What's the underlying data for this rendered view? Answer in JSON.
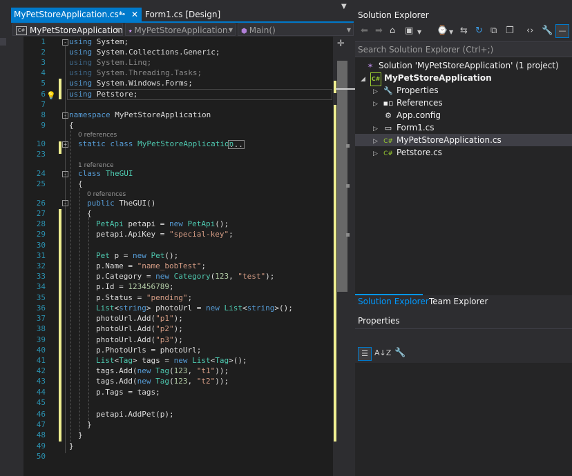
{
  "tabs": {
    "active_label": "MyPetStoreApplication.cs*",
    "pin_icon": "pin-icon",
    "close_icon": "close-icon",
    "second_label": "Form1.cs [Design]"
  },
  "nav": {
    "project": "MyPetStoreApplication",
    "class": "MyPetStoreApplication.",
    "member": "Main()"
  },
  "code": {
    "line_numbers": [
      "1",
      "2",
      "3",
      "4",
      "5",
      "6",
      "7",
      "8",
      "9",
      "10",
      "23",
      "24",
      "25",
      "26",
      "27",
      "28",
      "29",
      "30",
      "31",
      "32",
      "33",
      "34",
      "35",
      "36",
      "37",
      "38",
      "39",
      "40",
      "41",
      "42",
      "43",
      "44",
      "45",
      "46",
      "47",
      "48",
      "49",
      "50"
    ],
    "refs": {
      "r10": "0 references",
      "r24": "1 reference",
      "r26": "0 references"
    },
    "l1": [
      "using",
      " System;"
    ],
    "l2": [
      "using",
      " System.Collections.Generic;"
    ],
    "l3": [
      "using",
      " System.Linq;"
    ],
    "l4": [
      "using",
      " System.Threading.Tasks;"
    ],
    "l5": [
      "using",
      " System.Windows.Forms;"
    ],
    "l6": [
      "using",
      " Petstore;"
    ],
    "l8": [
      "namespace",
      " MyPetStoreApplication"
    ],
    "l9": "{",
    "l10": [
      "static",
      " ",
      "class",
      " ",
      "MyPetStoreApplication",
      "..."
    ],
    "l24": [
      "class",
      " ",
      "TheGUI"
    ],
    "l25": "{",
    "l26": [
      "public",
      " TheGUI()"
    ],
    "l27": "{",
    "l28": [
      "PetApi",
      " petapi = ",
      "new",
      " ",
      "PetApi",
      "();"
    ],
    "l29": [
      "petapi.ApiKey = ",
      "\"special-key\"",
      ";"
    ],
    "l31": [
      "Pet",
      " p = ",
      "new",
      " ",
      "Pet",
      "();"
    ],
    "l32": [
      "p.Name = ",
      "\"name_bobTest\"",
      ";"
    ],
    "l33": [
      "p.Category = ",
      "new",
      " ",
      "Category",
      "(",
      "123",
      ", ",
      "\"test\"",
      ");"
    ],
    "l34": [
      "p.Id = ",
      "123456789",
      ";"
    ],
    "l35": [
      "p.Status = ",
      "\"pending\"",
      ";"
    ],
    "l36": [
      "List",
      "<",
      "string",
      "> photoUrl = ",
      "new",
      " ",
      "List",
      "<",
      "string",
      ">();"
    ],
    "l37": [
      "photoUrl.Add(",
      "\"p1\"",
      ");"
    ],
    "l38": [
      "photoUrl.Add(",
      "\"p2\"",
      ");"
    ],
    "l39": [
      "photoUrl.Add(",
      "\"p3\"",
      ");"
    ],
    "l40": "p.PhotoUrls = photoUrl;",
    "l41": [
      "List",
      "<",
      "Tag",
      "> tags = ",
      "new",
      " ",
      "List",
      "<",
      "Tag",
      ">();"
    ],
    "l42": [
      "tags.Add(",
      "new",
      " ",
      "Tag",
      "(",
      "123",
      ", ",
      "\"t1\"",
      "));"
    ],
    "l43": [
      "tags.Add(",
      "new",
      " ",
      "Tag",
      "(",
      "123",
      ", ",
      "\"t2\"",
      "));"
    ],
    "l44": "p.Tags = tags;",
    "l46": "petapi.AddPet(p);",
    "l47": "}",
    "l48": "}",
    "l49": "}"
  },
  "solution_explorer": {
    "title": "Solution Explorer",
    "search_placeholder": "Search Solution Explorer (Ctrl+;)",
    "solution_label": "Solution 'MyPetStoreApplication' (1 project)",
    "project_label": "MyPetStoreApplication",
    "items": [
      {
        "label": "Properties",
        "icon": "wrench-icon"
      },
      {
        "label": "References",
        "icon": "references-icon"
      },
      {
        "label": "App.config",
        "icon": "config-file-icon"
      },
      {
        "label": "Form1.cs",
        "icon": "form-icon"
      },
      {
        "label": "MyPetStoreApplication.cs",
        "icon": "csharp-file-icon"
      },
      {
        "label": "Petstore.cs",
        "icon": "csharp-file-icon"
      }
    ]
  },
  "bottom_tabs": {
    "solution_explorer": "Solution Explorer",
    "team_explorer": "Team Explorer"
  },
  "properties": {
    "title": "Properties"
  },
  "colors": {
    "accent": "#007acc",
    "editor_bg": "#1e1e1e",
    "keyword": "#569cd6",
    "type": "#4ec9b0",
    "string": "#d69d85",
    "number": "#b5cea8",
    "line_number": "#2b91af",
    "change_marker": "#efef91"
  }
}
